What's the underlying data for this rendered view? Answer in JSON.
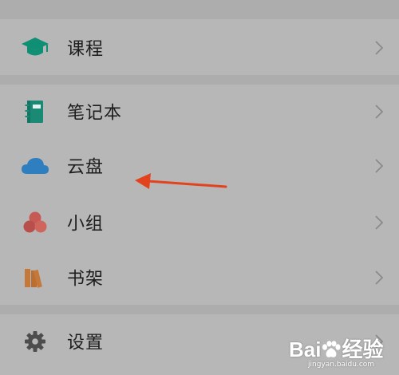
{
  "menu": {
    "items": [
      {
        "key": "course",
        "label": "课程",
        "icon": "graduation-cap-icon",
        "icon_color": "#0f8f74"
      },
      {
        "key": "notebook",
        "label": "笔记本",
        "icon": "notebook-icon",
        "icon_color": "#1a8a74"
      },
      {
        "key": "cloud",
        "label": "云盘",
        "icon": "cloud-icon",
        "icon_color": "#2f7fc0"
      },
      {
        "key": "group",
        "label": "小组",
        "icon": "group-circles-icon",
        "icon_color": "#c65b55"
      },
      {
        "key": "bookshelf",
        "label": "书架",
        "icon": "bookshelf-icon",
        "icon_color": "#c4793a"
      },
      {
        "key": "settings",
        "label": "设置",
        "icon": "gear-icon",
        "icon_color": "#4d4d4d"
      }
    ]
  },
  "annotation": {
    "arrow_color": "#e3421f",
    "points_to": "cloud"
  },
  "watermark": {
    "brand_before": "Bai",
    "brand_after": "经验",
    "url": "jingyan.baidu.com"
  }
}
